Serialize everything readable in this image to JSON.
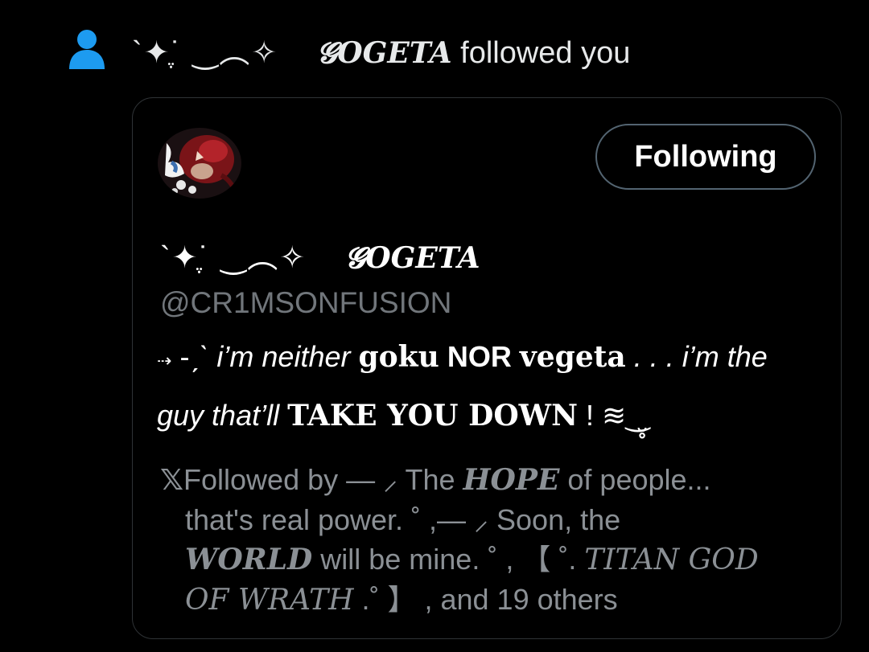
{
  "notification": {
    "icon": "person-icon",
    "icon_color": "#1d9bf0",
    "deco_prefix": "`✦˙ִֶ ‿︵✧",
    "display_name": "𝓖OGETA",
    "action_text": "followed you"
  },
  "card": {
    "avatar": "profile-avatar",
    "follow_button_label": "Following",
    "deco_prefix": "`✦˙ִֶ ‿︵✧",
    "display_name": "𝓖OGETA",
    "handle": "@CR1MSONFUSION",
    "bio": {
      "arrow": "⇢",
      "dash": "-ˏˋ",
      "part1": " i’m neither ",
      "goku": "goku",
      "nor": " NOR ",
      "vegeta": "vegeta",
      "part2": " . . . i’m the",
      "part3": "guy that’ll ",
      "take_you_down": "TAKE YOU DOWN",
      "ending": " ! ≋‿̮̥"
    },
    "followed_by": {
      "x_logo": "𝕏",
      "intro": "Followed by ― ",
      "follower1_a": "⸝ The ",
      "follower1_hope": "HOPE",
      "follower1_b": " of people...",
      "follower1_c": "that's real power. ˚  ,― ",
      "follower2_a": "⸝ Soon, the",
      "follower2_world": "WORLD",
      "follower2_b": " will be mine. ˚  , ",
      "follower3_a": "【 ˚. ",
      "follower3_titan": "TITAN GOD",
      "follower3_of": "OF WRATH",
      "follower3_b": " .˚ 】",
      "suffix": " , and 19 others"
    }
  }
}
